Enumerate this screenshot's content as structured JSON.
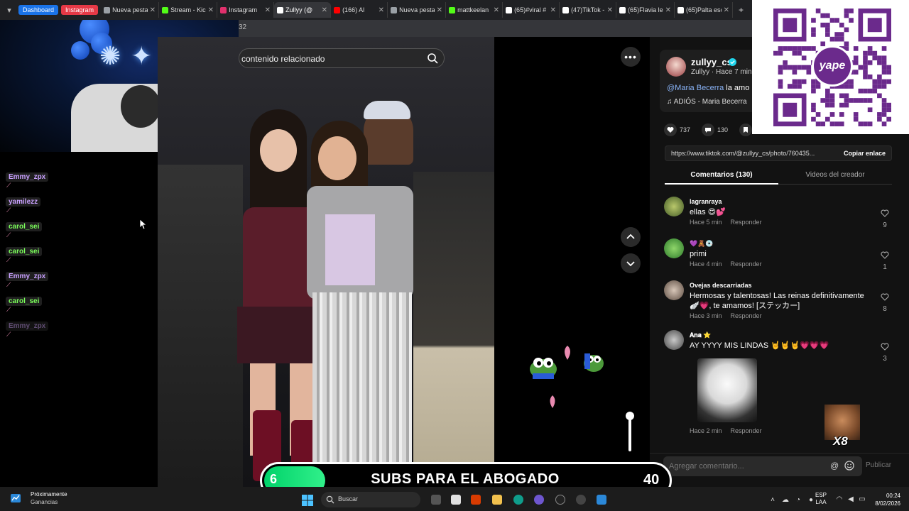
{
  "browser": {
    "tab_groups": [
      "Dashboard",
      "Instagram"
    ],
    "tabs": [
      {
        "label": "Nueva pesta",
        "color": "#9aa0a6"
      },
      {
        "label": "Stream - Kick",
        "color": "#53fc18"
      },
      {
        "label": "Instagram",
        "color": "#e1306c"
      },
      {
        "label": "Zullyy (@",
        "color": "#ffffff",
        "active": true
      },
      {
        "label": "(166) Al",
        "color": "#ff0000"
      },
      {
        "label": "Nueva pesta",
        "color": "#9aa0a6"
      },
      {
        "label": "mattkeelan",
        "color": "#53fc18"
      },
      {
        "label": "(65)#viral #",
        "color": "#ffffff"
      },
      {
        "label": "(47)TikTok -",
        "color": "#ffffff"
      },
      {
        "label": "(65)Flavia le",
        "color": "#ffffff"
      },
      {
        "label": "(65)Palta esc",
        "color": "#ffffff"
      }
    ],
    "address_fragment": "32"
  },
  "chat": {
    "messages": [
      {
        "name": "Emmy_zpx",
        "color": "#c9a0ff",
        "muted": false
      },
      {
        "name": "yamilezz",
        "color": "#c9a0ff",
        "muted": false
      },
      {
        "name": "carol_sei",
        "color": "#7bff5a",
        "muted": false
      },
      {
        "name": "carol_sei",
        "color": "#7bff5a",
        "muted": false
      },
      {
        "name": "Emmy_zpx",
        "color": "#c9a0ff",
        "muted": false
      },
      {
        "name": "carol_sei",
        "color": "#7bff5a",
        "muted": false
      },
      {
        "name": "Emmy_zpx",
        "color": "#a080c0",
        "muted": true
      }
    ]
  },
  "video": {
    "search_placeholder": "contenido relacionado",
    "more_label": "•••"
  },
  "post": {
    "username": "zullyy_cs",
    "author_meta": "Zullyy · Hace 7 min",
    "mention": "@Maria Becerra",
    "caption_rest": " la amo",
    "music": "ADIÓS - Maria Becerra",
    "likes": "737",
    "comments_count": "130",
    "link": "https://www.tiktok.com/@zullyy_cs/photo/760435...",
    "copy_label": "Copiar enlace",
    "tab_comments": "Comentarios (130)",
    "tab_videos": "Videos del creador"
  },
  "comments": [
    {
      "user": "lagranraya",
      "text": "ellas 😍💕",
      "time": "Hace 5 min",
      "reply": "Responder",
      "likes": "9"
    },
    {
      "user": "💜🧸💿",
      "text": "primi",
      "time": "Hace 4 min",
      "reply": "Responder",
      "likes": "1"
    },
    {
      "user": "Ovejas descarriadas",
      "text": "Hermosas y talentosas! Las reinas definitivamente 🪽💗, te amamos! [ステッカー]",
      "time": "Hace 3 min",
      "reply": "Responder",
      "likes": "8"
    },
    {
      "user": "𝐀𝐧𝐚 ⭐",
      "text": "AY YYYY MIS LINDAS 🤘🤘🤘💗💗💗",
      "time": "Hace 2 min",
      "reply": "Responder",
      "likes": "3"
    }
  ],
  "comment_input": {
    "placeholder": "Agregar comentario...",
    "at": "@",
    "publish": "Publicar"
  },
  "qr": {
    "brand": "yape",
    "brand_color": "#6b2a8c"
  },
  "goal": {
    "current": "6",
    "label": "SUBS PARA EL ABOGADO",
    "target": "40",
    "progress_fraction": 0.15
  },
  "x8": {
    "label": "X8"
  },
  "taskbar": {
    "weather_title": "Próximamente",
    "weather_sub": "Ganancias",
    "search_label": "Buscar",
    "lang_1": "ESP",
    "lang_2": "LAA",
    "time": "00:24",
    "date": "8/02/2026"
  }
}
